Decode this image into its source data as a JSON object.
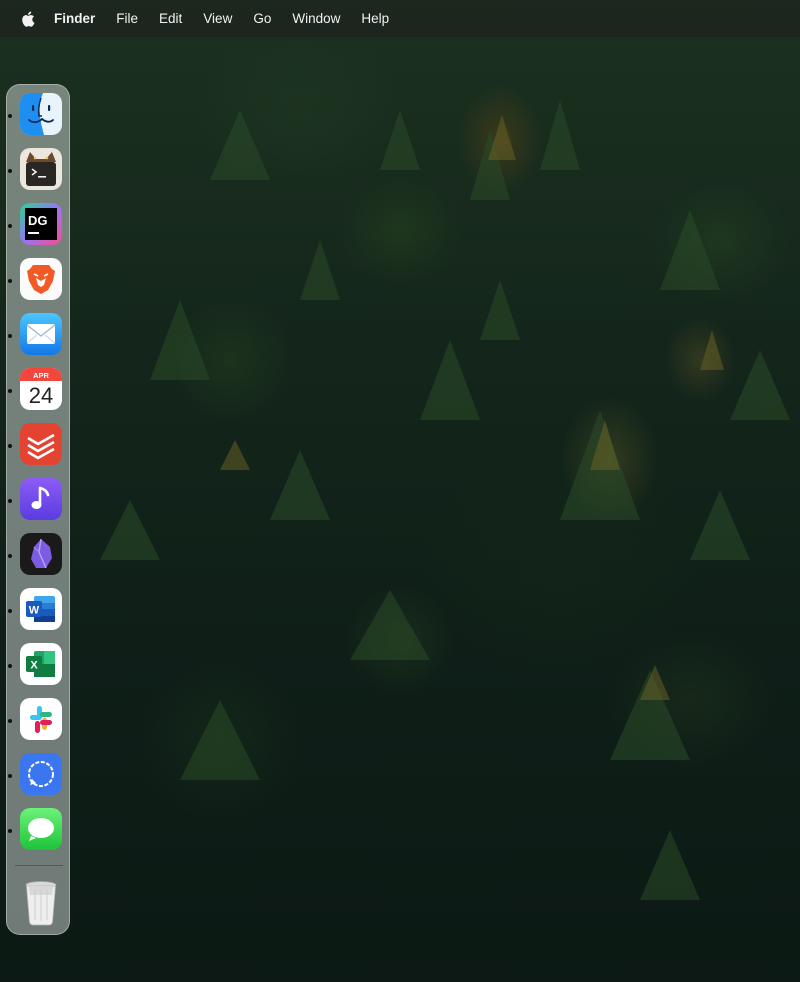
{
  "menubar": {
    "app_name": "Finder",
    "items": [
      "File",
      "Edit",
      "View",
      "Go",
      "Window",
      "Help"
    ]
  },
  "dock": {
    "apps": [
      {
        "name": "Finder",
        "icon": "finder-icon",
        "running": true
      },
      {
        "name": "Terminal",
        "icon": "terminal-icon",
        "running": true
      },
      {
        "name": "DataGrip",
        "icon": "datagrip-icon",
        "text": "DG",
        "running": true
      },
      {
        "name": "Brave Browser",
        "icon": "brave-icon",
        "running": true
      },
      {
        "name": "Mail",
        "icon": "mail-icon",
        "running": true
      },
      {
        "name": "Calendar",
        "icon": "calendar-icon",
        "month": "APR",
        "day": "24",
        "running": true
      },
      {
        "name": "Todoist",
        "icon": "todoist-icon",
        "running": true
      },
      {
        "name": "Music",
        "icon": "music-icon",
        "running": true
      },
      {
        "name": "Obsidian",
        "icon": "obsidian-icon",
        "running": true
      },
      {
        "name": "Microsoft Word",
        "icon": "word-icon",
        "text": "W",
        "running": true
      },
      {
        "name": "Microsoft Excel",
        "icon": "excel-icon",
        "text": "X",
        "running": true
      },
      {
        "name": "Slack",
        "icon": "slack-icon",
        "running": true
      },
      {
        "name": "Signal",
        "icon": "signal-icon",
        "running": true
      },
      {
        "name": "Messages",
        "icon": "messages-icon",
        "running": true
      }
    ],
    "trash": {
      "name": "Trash",
      "icon": "trash-icon"
    }
  }
}
